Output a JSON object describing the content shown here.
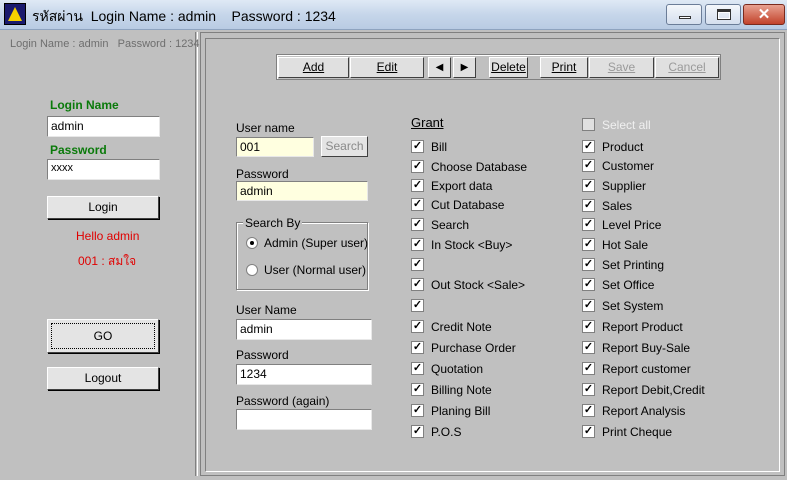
{
  "window": {
    "title": "รหัสผ่าน  Login Name : admin    Password : 1234",
    "minimize_icon": "minimize-icon",
    "maximize_icon": "maximize-icon",
    "close_icon": "close-icon",
    "close_glyph": "✕"
  },
  "left": {
    "header": "Login Name : admin   Password : 1234",
    "login_name_label": "Login Name",
    "login_name_value": "admin",
    "password_label": "Password",
    "password_value": "xxxx",
    "login_button": "Login",
    "hello_text": "Hello admin",
    "user_text": "001 : สมใจ",
    "go_button": "GO",
    "logout_button": "Logout"
  },
  "toolbar": {
    "add": "Add",
    "edit": "Edit",
    "prev": "◀",
    "next": "▶",
    "delete": "Delete",
    "print": "Print",
    "save": "Save",
    "cancel": "Cancel"
  },
  "form": {
    "user_name_label": "User name",
    "user_name_value": "001",
    "search_button": "Search",
    "password_label": "Password",
    "password_value": "admin",
    "search_by_title": "Search By",
    "radio_admin": "Admin (Super user)",
    "radio_user": "User (Normal user)",
    "user_name2_label": "User Name",
    "user_name2_value": "admin",
    "password2_label": "Password",
    "password2_value": "1234",
    "password_again_label": "Password (again)",
    "password_again_value": ""
  },
  "grant": {
    "title": "Grant",
    "select_all": "Select all",
    "check_mark": "✓",
    "left_items": [
      "Bill",
      "Choose Database",
      "Export data",
      "Cut Database",
      "Search",
      "In Stock <Buy>",
      "",
      "Out Stock <Sale>",
      "",
      "Credit Note",
      "Purchase Order",
      "Quotation",
      "Billing Note",
      "Planing Bill",
      "P.O.S"
    ],
    "right_items": [
      "Product",
      "Customer",
      "Supplier",
      "Sales",
      "Level Price",
      "Hot Sale",
      "Set Printing",
      "Set Office",
      "Set System",
      "Report Product",
      "Report Buy-Sale",
      "Report customer",
      "Report Debit,Credit",
      "Report Analysis",
      "Print Cheque"
    ]
  },
  "colors": {
    "panel": "#c0c0c0",
    "green_label": "#0a7a0a",
    "red_text": "#e00000",
    "yellow_field": "#ffffe0"
  }
}
